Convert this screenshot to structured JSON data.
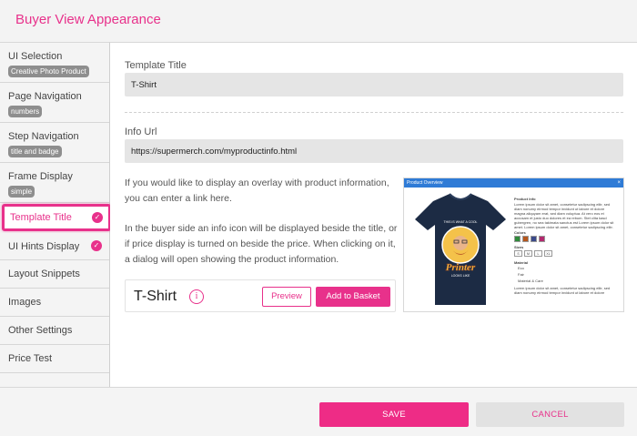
{
  "header": {
    "title": "Buyer View Appearance"
  },
  "sidebar": {
    "items": [
      {
        "label": "UI Selection",
        "badge": "Creative Photo Product"
      },
      {
        "label": "Page Navigation",
        "badge": "numbers"
      },
      {
        "label": "Step Navigation",
        "badge": "title and badge"
      },
      {
        "label": "Frame Display",
        "badge": "simple"
      },
      {
        "label": "Template Title",
        "checked": true,
        "active": true
      },
      {
        "label": "UI Hints Display",
        "checked": true
      },
      {
        "label": "Layout Snippets"
      },
      {
        "label": "Images"
      },
      {
        "label": "Other Settings"
      },
      {
        "label": "Price Test"
      }
    ]
  },
  "main": {
    "template_title": {
      "label": "Template Title",
      "value": "T-Shirt"
    },
    "info_url": {
      "label": "Info Url",
      "value": "https://supermerch.com/myproductinfo.html"
    },
    "description_1": "If you would like to display an overlay with product information, you can enter a link here.",
    "description_2": "In the buyer side an info icon will be displayed beside the title, or if price display is turned on beside the price. When clicking on it, a dialog will open showing the product information.",
    "preview": {
      "title": "T-Shirt",
      "info_icon": "i",
      "preview_label": "Preview",
      "basket_label": "Add to Basket"
    },
    "overlay_image": {
      "header": "Product Overview",
      "close": "×",
      "shirt_text_top": "THIS IS WHAT A COOL",
      "shirt_text_main": "Printer",
      "shirt_text_bottom": "LOOKS LIKE",
      "info_heading": "Product Info",
      "info_body": "Lorem ipsum dolor sit amet, consetetur sadipscing elitr, sed diam nonumy eirmod tempor invidunt ut labore et dolore magna aliquyam erat, sed diam voluptua. At vero eos et accusam et justo duo dolores et ea rebum. Stet clita kasd gubergren, no sea takimata sanctus est Lorem ipsum dolor sit amet. Lorem ipsum dolor sit amet, consetetur sadipscing elitr.",
      "colors_heading": "Colors",
      "colors": [
        "#2f8a3a",
        "#b5561c",
        "#3b4a8a",
        "#b2296e"
      ],
      "sizes_heading": "Sizes",
      "sizes": [
        "S",
        "M",
        "L",
        "XL"
      ],
      "material_heading": "Material",
      "materials": [
        "Eco",
        "Fair",
        "Material & Care"
      ],
      "footer_text": "Lorem ipsum dolor sit amet, consetetur sadipscing elitr, sed diam nonumy eirmod tempor invidunt ut labore et dolore magna aliquyam erat, sed diam voluptua."
    }
  },
  "footer": {
    "save_label": "SAVE",
    "cancel_label": "CANCEL"
  },
  "colors": {
    "accent": "#e8318b",
    "badge": "#8e8e8e",
    "input_bg": "#e5e5e5",
    "overlay_header": "#2f7bd6",
    "shirt": "#1c2b44"
  }
}
